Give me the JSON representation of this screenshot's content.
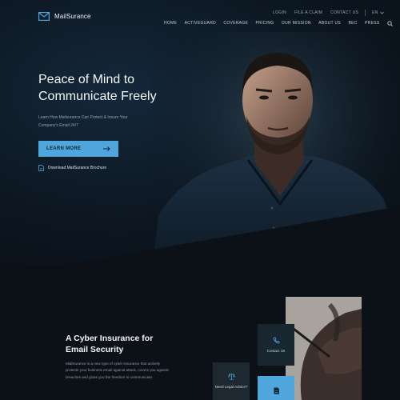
{
  "brand": {
    "name": "MailSurance"
  },
  "utility_nav": [
    "LOGIN",
    "FILE A CLAIM",
    "CONTACT US"
  ],
  "language": "EN",
  "main_nav": [
    "HOME",
    "ACTIVEGUARD",
    "COVERAGE",
    "PRICING",
    "OUR MISSION",
    "ABOUT US",
    "BEC",
    "PRESS"
  ],
  "hero": {
    "title": "Peace of Mind to Communicate Freely",
    "subtitle": "Learn How Mailsurance Can Protect & Insure Your Company's Email 24/7",
    "cta_label": "LEARN MORE",
    "download_label": "Download MailSurance Brochure"
  },
  "section": {
    "title": "A Cyber Insurance for Email Security",
    "body": "MailSurance is a new type of cyber insurance that actively protects your business email against attack, covers you against breaches and gives you the freedom to communicate."
  },
  "cards": {
    "contact": "Contact Us",
    "legal": "Need Legal Advice?"
  },
  "colors": {
    "accent": "#4ea6dc",
    "background": "#0b1116"
  },
  "icons": [
    "envelope-icon",
    "chevron-down-icon",
    "search-icon",
    "arrow-right-icon",
    "document-icon",
    "phone-icon",
    "scales-icon"
  ]
}
